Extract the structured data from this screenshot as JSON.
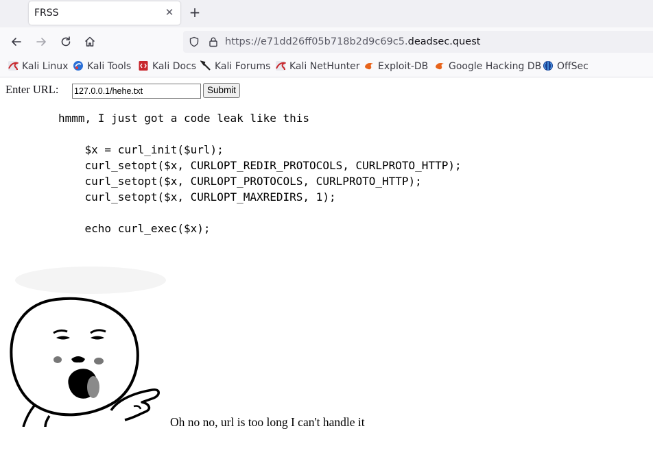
{
  "browser": {
    "tab_title": "FRSS",
    "url_prefix": "https://e71dd26ff05b718b2d9c69c5.",
    "url_host": "deadsec.quest",
    "bookmarks": [
      {
        "label": "Kali Linux",
        "icon": "kali-dragon-icon"
      },
      {
        "label": "Kali Tools",
        "icon": "kali-tools-icon"
      },
      {
        "label": "Kali Docs",
        "icon": "kali-docs-icon"
      },
      {
        "label": "Kali Forums",
        "icon": "kali-forums-icon"
      },
      {
        "label": "Kali NetHunter",
        "icon": "kali-dragon-icon"
      },
      {
        "label": "Exploit-DB",
        "icon": "exploit-db-icon"
      },
      {
        "label": "Google Hacking DB",
        "icon": "exploit-db-icon"
      },
      {
        "label": "OffSec",
        "icon": "offsec-icon"
      }
    ]
  },
  "form": {
    "label": "Enter URL:",
    "input_value": "127.0.0.1/hehe.txt",
    "submit_label": "Submit"
  },
  "code_leak": "hmmm, I just got a code leak like this\n\n    $x = curl_init($url);\n    curl_setopt($x, CURLOPT_REDIR_PROTOCOLS, CURLPROTO_HTTP);\n    curl_setopt($x, CURLOPT_PROTOCOLS, CURLPROTO_HTTP);\n    curl_setopt($x, CURLOPT_MAXREDIRS, 1);\n\n    echo curl_exec($x);",
  "caption": "Oh no no, url is too long I can't handle it"
}
